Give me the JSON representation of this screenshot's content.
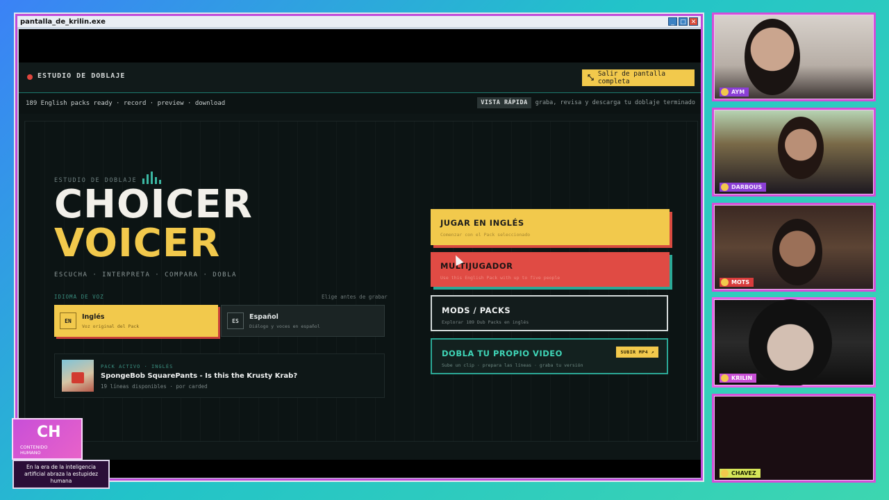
{
  "window": {
    "title": "pantalla_de_krilin.exe",
    "buttons": [
      "_",
      "□",
      "✕"
    ]
  },
  "app": {
    "topbar": {
      "studio_label": "ESTUDIO DE DOBLAJE",
      "exit_button": "Salir de pantalla completa",
      "exit_icon": "fullscreen-exit-icon"
    },
    "status": {
      "left": "189 English packs ready · record · preview · download",
      "quick_badge": "VISTA RÁPIDA",
      "quick_text": "graba, revisa y descarga tu doblaje terminado"
    },
    "hero": {
      "kicker": "ESTUDIO DE DOBLAJE",
      "title_line1": "CHOICER",
      "title_line2": "VOICER",
      "steps": "ESCUCHA · INTERPRETA · COMPARA · DOBLA"
    },
    "voice": {
      "label": "IDIOMA DE VOZ",
      "hint": "Elige antes de grabar",
      "options": [
        {
          "code": "EN",
          "name": "Inglés",
          "sub": "Voz original del Pack"
        },
        {
          "code": "ES",
          "name": "Español",
          "sub": "Diálogo y voces en español"
        }
      ]
    },
    "pack": {
      "kicker": "PACK ACTIVO · INGLÉS",
      "title": "SpongeBob SquarePants - Is this the Krusty Krab?",
      "meta": "19 líneas disponibles · por carded"
    },
    "menu": {
      "play": {
        "title": "JUGAR EN INGLÉS",
        "sub": "Comenzar con el Pack seleccionado"
      },
      "multi": {
        "title": "MULTIJUGADOR",
        "sub": "Use this English Pack with up to five people"
      },
      "mods": {
        "title": "MODS / PACKS",
        "sub": "Explorar 189 Dub Packs en inglés"
      },
      "dub": {
        "title": "DOBLA TU PROPIO VIDEO",
        "sub": "Sube un clip · prepara las líneas · graba tu versión",
        "chip": "SUBIR MP4 ↗"
      }
    }
  },
  "cams": [
    {
      "name": "AYM"
    },
    {
      "name": "DARBOUS"
    },
    {
      "name": "MOTS"
    },
    {
      "name": "KRILIN"
    },
    {
      "name": "CHAVEZ"
    }
  ],
  "logo": {
    "letters": "CH",
    "sub": "CONTENIDO HUMANO",
    "tagline": "En la era de la inteligencia artificial abraza la estupidez humana"
  },
  "colors": {
    "accent_yellow": "#f2c94c",
    "accent_red": "#e04b44",
    "accent_teal": "#2ba896",
    "frame_magenta": "#d34fd8"
  }
}
